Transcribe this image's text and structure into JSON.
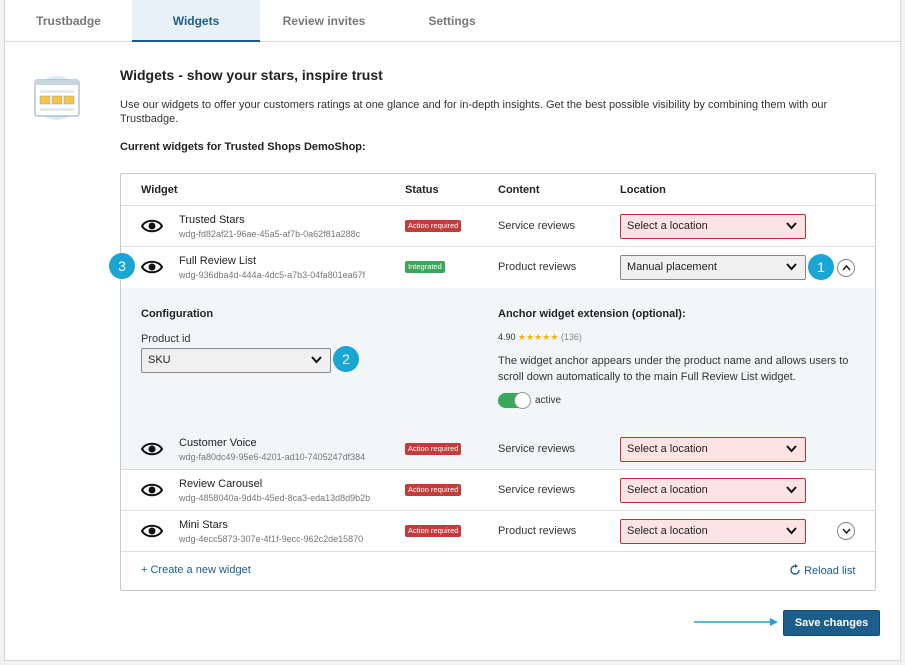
{
  "tabs": [
    {
      "label": "Trustbadge"
    },
    {
      "label": "Widgets"
    },
    {
      "label": "Review invites"
    },
    {
      "label": "Settings"
    }
  ],
  "header": {
    "title": "Widgets - show your stars, inspire trust",
    "intro": "Use our widgets to offer your customers ratings at one glance and for in-depth insights. Get the best possible visibility by combining them with our Trustbadge.",
    "current": "Current widgets for Trusted Shops DemoShop:"
  },
  "table": {
    "columns": {
      "widget": "Widget",
      "status": "Status",
      "content": "Content",
      "location": "Location"
    },
    "rows": [
      {
        "name": "Trusted Stars",
        "id": "wdg-fd82af21-96ae-45a5-af7b-0a62f81a288c",
        "status": "Action required",
        "content": "Service reviews",
        "location": "Select a location"
      },
      {
        "name": "Full Review List",
        "id": "wdg-936dba4d-444a-4dc5-a7b3-04fa801ea67f",
        "status": "Integrated",
        "content": "Product reviews",
        "location": "Manual placement"
      },
      {
        "name": "Customer Voice",
        "id": "wdg-fa80dc49-95e6-4201-ad10-7405247df384",
        "status": "Action required",
        "content": "Service reviews",
        "location": "Select a location"
      },
      {
        "name": "Review Carousel",
        "id": "wdg-4858040a-9d4b-45ed-8ca3-eda13d8d9b2b",
        "status": "Action required",
        "content": "Service reviews",
        "location": "Select a location"
      },
      {
        "name": "Mini Stars",
        "id": "wdg-4ecc5873-307e-4f1f-9ecc-962c2de15870",
        "status": "Action required",
        "content": "Product reviews",
        "location": "Select a location"
      }
    ]
  },
  "config": {
    "heading": "Configuration",
    "product_id_label": "Product id",
    "product_id_value": "SKU",
    "anchor_heading": "Anchor widget extension (optional):",
    "rating_value": "4.90",
    "rating_stars": "★★★★★",
    "rating_count": "(136)",
    "anchor_text": "The widget anchor appears under the product name and allows users to scroll down automatically to the main Full Review List widget.",
    "toggle_label": "active"
  },
  "callouts": {
    "one": "1",
    "two": "2",
    "three": "3"
  },
  "footer": {
    "create_link": "+ Create a new widget",
    "reload_link": "Reload list",
    "save_label": "Save changes"
  },
  "colors": {
    "accent": "#1b5e8c",
    "callout": "#1aa5d4",
    "danger": "#c43b3b",
    "success": "#3aa85a"
  },
  "icons": [
    "widgets-illustration-icon",
    "eye-icon",
    "chevron-down-icon",
    "chevron-up-icon",
    "reload-icon",
    "arrow-right-icon"
  ]
}
